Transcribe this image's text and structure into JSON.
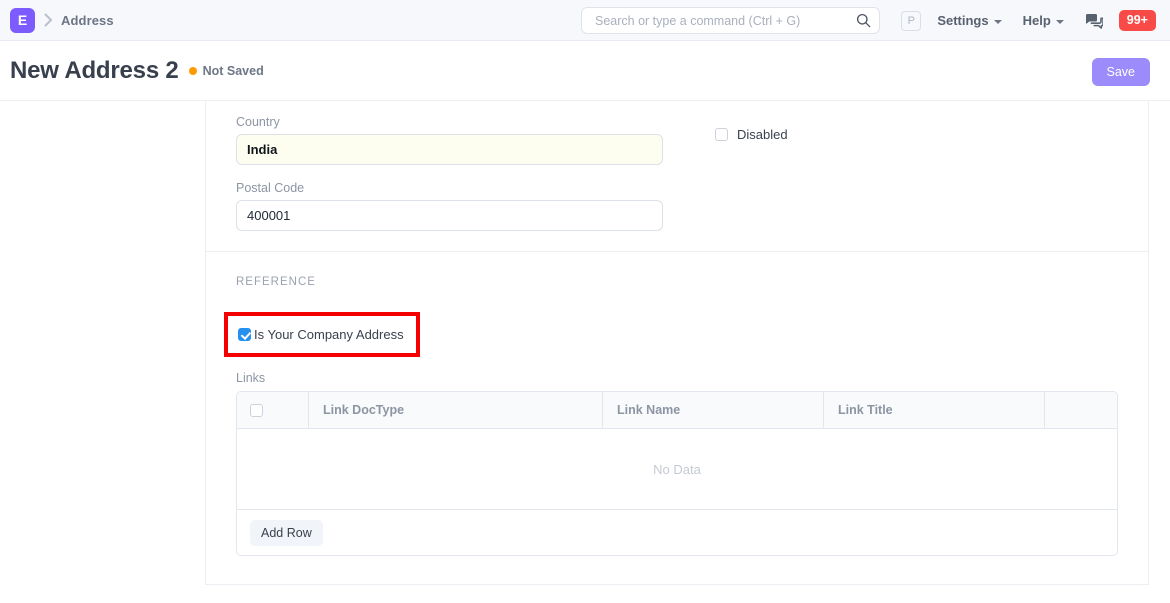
{
  "navbar": {
    "logo_letter": "E",
    "breadcrumb": "Address",
    "search": {
      "placeholder": "Search or type a command (Ctrl + G)",
      "value": "",
      "icon": "search-icon"
    },
    "avatar_letter": "P",
    "menus": [
      {
        "label": "Settings"
      },
      {
        "label": "Help"
      }
    ],
    "chat_icon": "chat-bubbles-icon",
    "notification_count": "99+"
  },
  "page_head": {
    "title": "New Address 2",
    "status": "Not Saved",
    "status_color": "#ff9a00",
    "save_label": "Save"
  },
  "form": {
    "address_section": {
      "country": {
        "label": "Country",
        "value": "India"
      },
      "postal_code": {
        "label": "Postal Code",
        "value": "400001"
      },
      "disabled": {
        "label": "Disabled",
        "checked": false
      }
    },
    "reference_section": {
      "heading": "REFERENCE",
      "is_company_address": {
        "label": "Is Your Company Address",
        "checked": true,
        "highlight_color": "#f50000"
      },
      "links": {
        "label": "Links",
        "columns": [
          "",
          "Link DocType",
          "Link Name",
          "Link Title",
          ""
        ],
        "rows": [],
        "empty_text": "No Data",
        "add_row_label": "Add Row"
      }
    }
  }
}
